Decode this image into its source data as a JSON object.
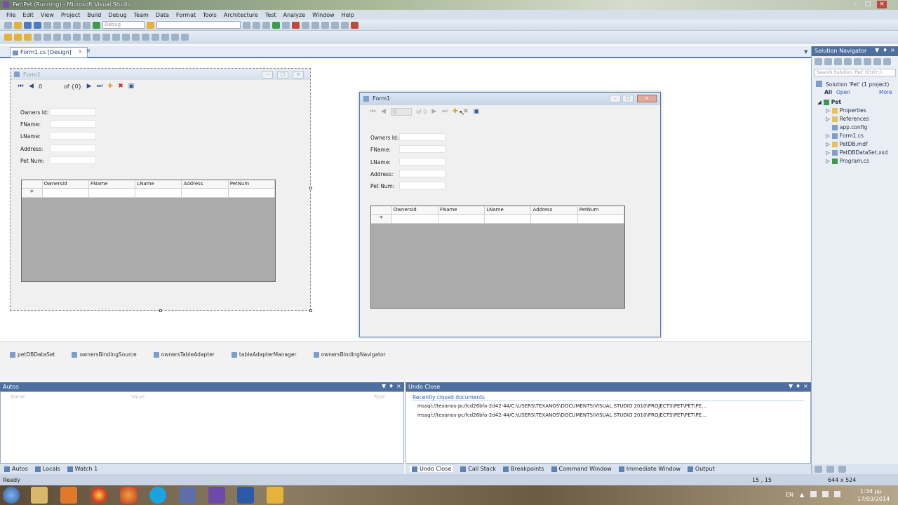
{
  "window": {
    "title": "Pet\\Pet (Running) - Microsoft Visual Studio"
  },
  "menu": [
    "File",
    "Edit",
    "View",
    "Project",
    "Build",
    "Debug",
    "Team",
    "Data",
    "Format",
    "Tools",
    "Architecture",
    "Test",
    "Analyze",
    "Window",
    "Help"
  ],
  "toolbar": {
    "config": "Debug"
  },
  "doc_tab": {
    "label": "Form1.cs [Design]",
    "pin": "×",
    "close": "×"
  },
  "designer_form": {
    "title": "Form1",
    "nav": {
      "position": "0",
      "count": "of {0}"
    },
    "fields": [
      "Owners Id:",
      "FName:",
      "LName:",
      "Address:",
      "Pet Num:"
    ],
    "columns": [
      "OwnersId",
      "FName",
      "LName",
      "Address",
      "PetNum"
    ],
    "new_row_marker": "*"
  },
  "running_form": {
    "title": "Form1",
    "nav": {
      "position": "0",
      "count": "of 0"
    },
    "fields": [
      "Owners Id:",
      "FName:",
      "LName:",
      "Address:",
      "Pet Num:"
    ],
    "columns": [
      "OwnersId",
      "FName",
      "LName",
      "Address",
      "PetNum"
    ],
    "new_row_marker": "*"
  },
  "tray": [
    "petDBDataSet",
    "ownersBindingSource",
    "ownersTableAdapter",
    "tableAdapterManager",
    "ownersBindingNavigator"
  ],
  "autos": {
    "title": "Autos",
    "columns": [
      "Name",
      "Value",
      "Type"
    ],
    "tabs": [
      "Autos",
      "Locals",
      "Watch 1"
    ]
  },
  "undo_close": {
    "title": "Undo Close",
    "heading": "Recently closed documents",
    "items": [
      "mssql://texanos-pc/fcd26bfa-2d42-44/C:\\USERS\\TEXANOS\\DOCUMENTS\\VISUAL STUDIO 2010\\PROJECTS\\PET\\PET\\PE...",
      "mssql://texanos-pc/fcd26bfa-2d42-44/C:\\USERS\\TEXANOS\\DOCUMENTS\\VISUAL STUDIO 2010\\PROJECTS\\PET\\PET\\PE..."
    ],
    "tabs": [
      "Undo Close",
      "Call Stack",
      "Breakpoints",
      "Command Window",
      "Immediate Window",
      "Output"
    ]
  },
  "solution": {
    "title": "Solution Navigator",
    "search_placeholder": "Search Solution 'Pet' (Ctrl+;)",
    "filter_all": "All",
    "filter_open": "Open",
    "filter_more": "More",
    "solution_label": "Solution 'Pet' (1 project)",
    "project": "Pet",
    "items": [
      "Properties",
      "References",
      "app.config",
      "Form1.cs",
      "PetDB.mdf",
      "PetDBDataSet.xsd",
      "Program.cs"
    ]
  },
  "status": {
    "text": "Ready",
    "position": "15 , 15",
    "size": "644 x 524"
  },
  "tray_clock": {
    "lang": "EN",
    "time": "1:34 μμ",
    "date": "17/03/2014"
  }
}
